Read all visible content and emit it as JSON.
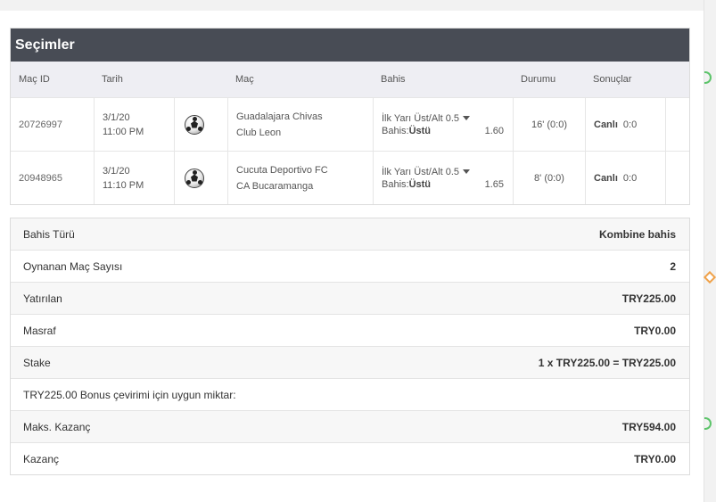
{
  "selections": {
    "title": "Seçimler",
    "columns": [
      "Maç ID",
      "Tarih",
      "Maç",
      "Bahis",
      "Durumu",
      "Sonuçlar"
    ],
    "rows": [
      {
        "id": "20726997",
        "date": "3/1/20",
        "time": "11:00 PM",
        "home": "Guadalajara Chivas",
        "away": "Club Leon",
        "market": "İlk Yarı Üst/Alt 0.5",
        "bet_label": "Bahis:",
        "bet_selection": "Üstü",
        "odds": "1.60",
        "status": "16' (0:0)",
        "result_label": "Canlı",
        "result_score": "0:0"
      },
      {
        "id": "20948965",
        "date": "3/1/20",
        "time": "11:10 PM",
        "home": "Cucuta Deportivo FC",
        "away": "CA Bucaramanga",
        "market": "İlk Yarı Üst/Alt 0.5",
        "bet_label": "Bahis:",
        "bet_selection": "Üstü",
        "odds": "1.65",
        "status": "8' (0:0)",
        "result_label": "Canlı",
        "result_score": "0:0"
      }
    ]
  },
  "summary": [
    {
      "label": "Bahis Türü",
      "value": "Kombine bahis"
    },
    {
      "label": "Oynanan Maç Sayısı",
      "value": "2"
    },
    {
      "label": "Yatırılan",
      "value": "TRY225.00"
    },
    {
      "label": "Masraf",
      "value": "TRY0.00"
    },
    {
      "label": "Stake",
      "value": "1 x TRY225.00 = TRY225.00"
    },
    {
      "label": "TRY225.00 Bonus çevirimi için uygun miktar:",
      "value": ""
    },
    {
      "label": "Maks. Kazanç",
      "value": "TRY594.00"
    },
    {
      "label": "Kazanç",
      "value": "TRY0.00"
    }
  ],
  "colors": {
    "header_bg": "#484c55",
    "column_header_bg": "#eeeef3",
    "edge_green": "#5cc46a",
    "edge_orange": "#f0a24a"
  },
  "icons": {
    "match_icon": "soccer-ball-icon",
    "dropdown_icon": "caret-down-icon"
  }
}
